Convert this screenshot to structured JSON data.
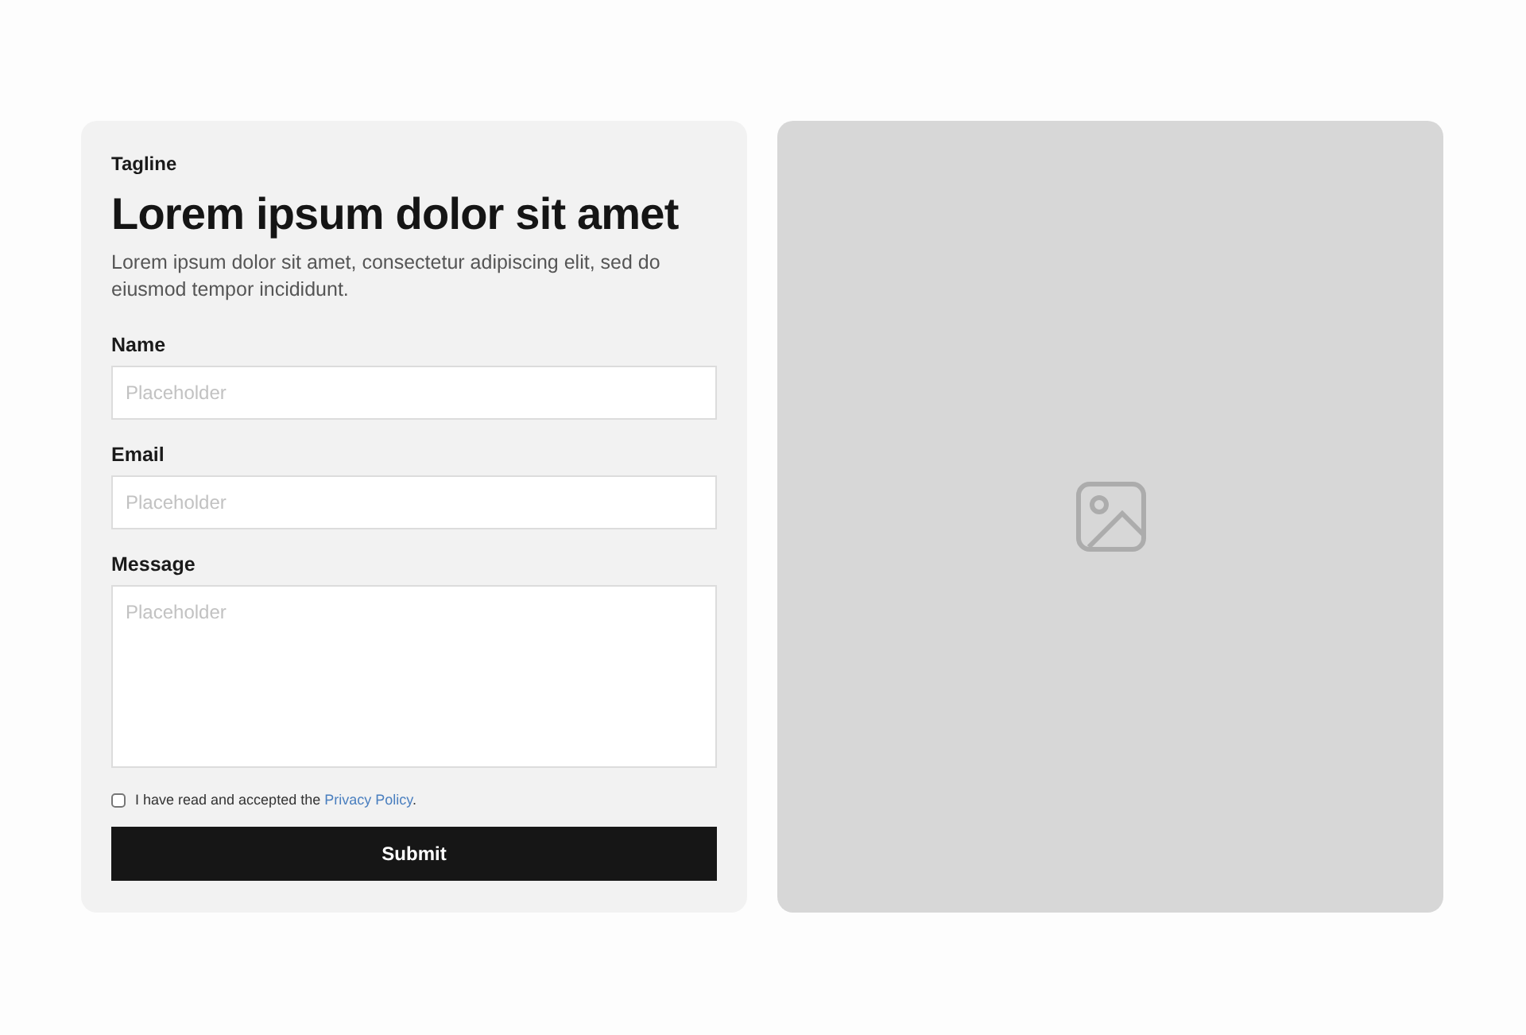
{
  "tagline": "Tagline",
  "heading": "Lorem ipsum dolor sit amet",
  "description": "Lorem ipsum dolor sit amet, consectetur adipiscing elit, sed do eiusmod tempor incididunt.",
  "fields": [
    {
      "kind": "input",
      "label": "Name",
      "placeholder": "Placeholder"
    },
    {
      "kind": "input",
      "label": "Email",
      "placeholder": "Placeholder"
    },
    {
      "kind": "textarea",
      "label": "Message",
      "placeholder": "Placeholder"
    }
  ],
  "consent": {
    "checked": false,
    "text": "I have read and accepted the ",
    "link": "Privacy Policy",
    "after": "."
  },
  "submit": "Submit",
  "image": {
    "kind": "placeholder"
  }
}
